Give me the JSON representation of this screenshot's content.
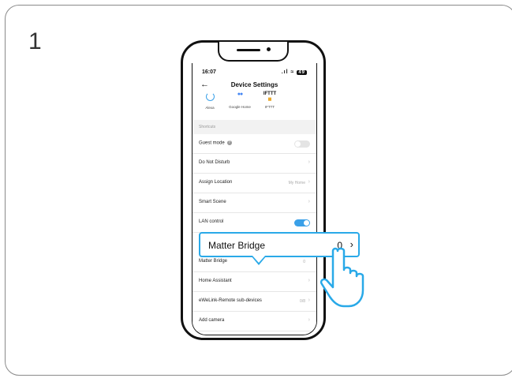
{
  "step": "1",
  "status_bar": {
    "time": "16:07",
    "signal": ".ıl",
    "wifi": "≈",
    "battery": "49"
  },
  "nav": {
    "back_icon": "arrow-left-icon",
    "title": "Device Settings"
  },
  "integrations": [
    {
      "label": "Alexa",
      "icon": "alexa-icon"
    },
    {
      "label": "Google Home",
      "icon": "google-home-icon"
    },
    {
      "label": "IFTTT",
      "icon": "ifttt-icon",
      "logo_text": "IFTTT"
    }
  ],
  "section": {
    "title": "Shortcuts"
  },
  "rows": [
    {
      "label": "Guest mode",
      "control": "toggle-off"
    },
    {
      "label": "Do Not Disturb",
      "value": ""
    },
    {
      "label": "Assign Location",
      "value": "My Home"
    },
    {
      "label": "Smart Scene",
      "value": ""
    },
    {
      "label": "LAN control",
      "control": "toggle-on"
    },
    {
      "label": "Matter Bridge",
      "value": "0"
    },
    {
      "label": "Home Assistant",
      "value": ""
    },
    {
      "label": "eWeLink-Remote sub-devices",
      "value": "0/8"
    },
    {
      "label": "Add camera",
      "value": ""
    }
  ],
  "callout": {
    "label": "Matter Bridge",
    "value": "0",
    "chevron": "›"
  },
  "colors": {
    "accent": "#29a9e8",
    "toggle_on": "#3aa0e8"
  }
}
